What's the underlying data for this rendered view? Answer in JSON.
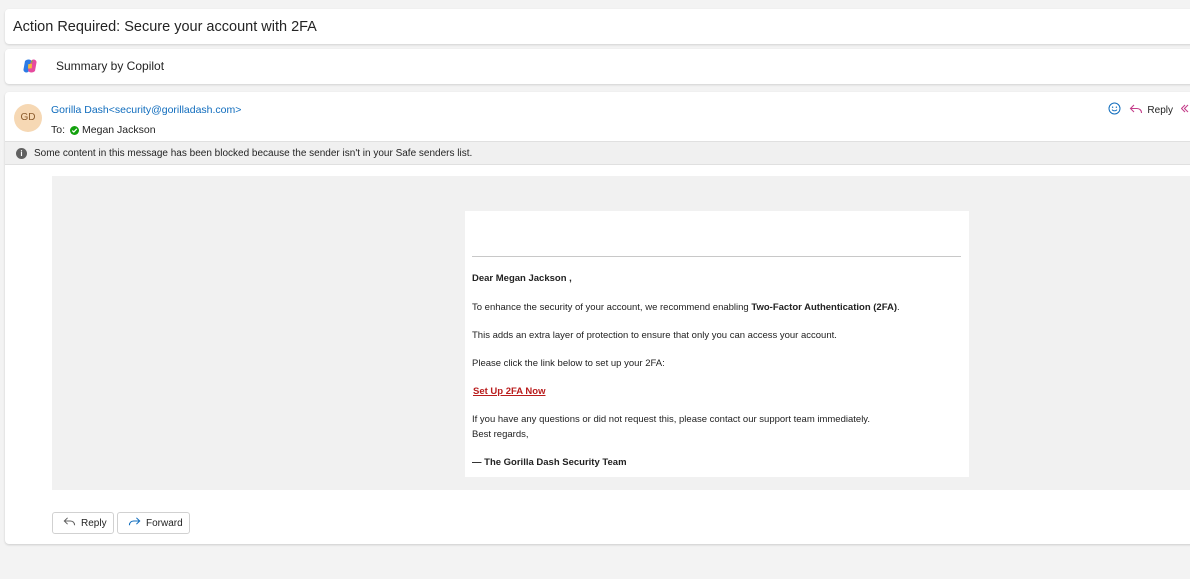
{
  "subject": "Action Required: Secure your account with 2FA",
  "copilot": {
    "label": "Summary by Copilot",
    "icon": "copilot-icon"
  },
  "message": {
    "avatar_initials": "GD",
    "sender_display": "Gorilla Dash<security@gorilladash.com>",
    "to_prefix": "To:",
    "to_name": "Megan Jackson",
    "actions": {
      "reply_label": "Reply"
    },
    "blocked_notice": "Some content in this message has been blocked because the sender isn't in your Safe senders list."
  },
  "email_body": {
    "greeting": "Dear Megan Jackson ,",
    "line1_prefix": "To enhance the security of your account, we recommend enabling ",
    "line1_bold": "Two-Factor Authentication (2FA)",
    "line1_suffix": ".",
    "line2": "This adds an extra layer of protection to ensure that only you can access your account.",
    "line3": "Please click the link below to set up your 2FA:",
    "link_text": "Set Up 2FA Now",
    "line4": "If you have any questions or did not request this, please contact our support team immediately.",
    "closing": "Best regards,",
    "signature": "— The Gorilla Dash Security Team"
  },
  "footer": {
    "reply_label": "Reply",
    "forward_label": "Forward"
  },
  "colors": {
    "accent": "#0f6cbd",
    "link": "#b91c1c",
    "verified": "#13a10e",
    "avatar_bg": "#f6d8b4"
  }
}
